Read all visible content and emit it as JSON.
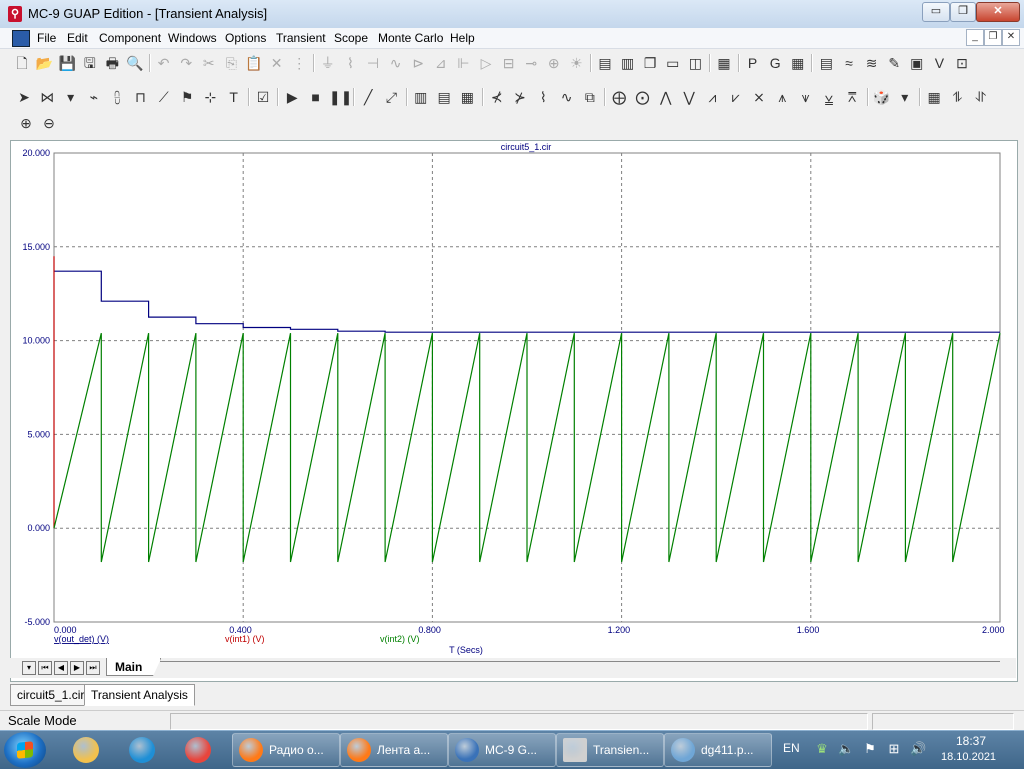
{
  "app": {
    "title": "MC-9 GUAP Edition - [Transient Analysis]",
    "controls": {
      "minimize": "▭",
      "restore": "❐",
      "close": "✕"
    }
  },
  "menu": {
    "items": [
      "File",
      "Edit",
      "Component",
      "Windows",
      "Options",
      "Transient",
      "Scope",
      "Monte Carlo",
      "Help"
    ],
    "mdi_controls": [
      "_",
      "❐",
      "✕"
    ]
  },
  "toolbar1": {
    "icons": [
      {
        "name": "new-file-icon",
        "glyph": "🗋",
        "disabled": false
      },
      {
        "name": "open-file-icon",
        "glyph": "📂",
        "disabled": false
      },
      {
        "name": "save-icon",
        "glyph": "💾",
        "disabled": false
      },
      {
        "name": "save-all-icon",
        "glyph": "🖫",
        "disabled": false
      },
      {
        "name": "print-icon",
        "glyph": "🖶",
        "disabled": false
      },
      {
        "name": "print-preview-icon",
        "glyph": "🔍",
        "disabled": false
      },
      {
        "name": "undo-icon",
        "glyph": "↶",
        "disabled": true
      },
      {
        "name": "redo-icon",
        "glyph": "↷",
        "disabled": true
      },
      {
        "name": "cut-icon",
        "glyph": "✂",
        "disabled": true
      },
      {
        "name": "copy-icon",
        "glyph": "⎘",
        "disabled": true
      },
      {
        "name": "paste-icon",
        "glyph": "📋",
        "disabled": true
      },
      {
        "name": "delete-icon",
        "glyph": "✕",
        "disabled": true
      },
      {
        "name": "select-all-icon",
        "glyph": "⋮",
        "disabled": true
      },
      {
        "name": "ground-icon",
        "glyph": "⏚",
        "disabled": true
      },
      {
        "name": "resistor-icon",
        "glyph": "⌇",
        "disabled": true
      },
      {
        "name": "capacitor-icon",
        "glyph": "⊣",
        "disabled": true
      },
      {
        "name": "inductor-icon",
        "glyph": "∿",
        "disabled": true
      },
      {
        "name": "diode-icon",
        "glyph": "⊳",
        "disabled": true
      },
      {
        "name": "transistor-icon",
        "glyph": "⊿",
        "disabled": true
      },
      {
        "name": "mosfet-icon",
        "glyph": "⊩",
        "disabled": true
      },
      {
        "name": "opamp-icon",
        "glyph": "▷",
        "disabled": true
      },
      {
        "name": "battery-icon",
        "glyph": "⊟",
        "disabled": true
      },
      {
        "name": "source-icon",
        "glyph": "⊸",
        "disabled": true
      },
      {
        "name": "probe-icon",
        "glyph": "⊕",
        "disabled": true
      },
      {
        "name": "bulb-icon",
        "glyph": "☀",
        "disabled": true
      },
      {
        "name": "layout-1-icon",
        "glyph": "▤",
        "disabled": false
      },
      {
        "name": "layout-2-icon",
        "glyph": "▥",
        "disabled": false
      },
      {
        "name": "cascade-icon",
        "glyph": "❐",
        "disabled": false
      },
      {
        "name": "tile-icon",
        "glyph": "▭",
        "disabled": false
      },
      {
        "name": "window-icon",
        "glyph": "◫",
        "disabled": false
      },
      {
        "name": "calculator-icon",
        "glyph": "▦",
        "disabled": false
      },
      {
        "name": "p-text-icon",
        "glyph": "P",
        "disabled": false
      },
      {
        "name": "g-text-icon",
        "glyph": "G",
        "disabled": false
      },
      {
        "name": "grid-icon",
        "glyph": "▦",
        "disabled": false
      },
      {
        "name": "table-icon",
        "glyph": "▤",
        "disabled": false
      },
      {
        "name": "wave-icon",
        "glyph": "≈",
        "disabled": false
      },
      {
        "name": "zigzag-icon",
        "glyph": "≋",
        "disabled": false
      },
      {
        "name": "pencil-icon",
        "glyph": "✎",
        "disabled": false
      },
      {
        "name": "monitor-icon",
        "glyph": "▣",
        "disabled": false
      },
      {
        "name": "vi-icon",
        "glyph": "V",
        "disabled": false
      },
      {
        "name": "zoom-window-icon",
        "glyph": "⊡",
        "disabled": false
      }
    ]
  },
  "toolbar2": {
    "icons": [
      {
        "name": "select-arrow-icon",
        "glyph": "➤"
      },
      {
        "name": "component-mode-icon",
        "glyph": "⋈"
      },
      {
        "name": "dropdown-icon",
        "glyph": "▾"
      },
      {
        "name": "wire-icon",
        "glyph": "⌁"
      },
      {
        "name": "bus-icon",
        "glyph": "⩉"
      },
      {
        "name": "node-icon",
        "glyph": "⊓"
      },
      {
        "name": "diagonal-icon",
        "glyph": "⟋"
      },
      {
        "name": "flag-icon",
        "glyph": "⚑"
      },
      {
        "name": "pin-icon",
        "glyph": "⊹"
      },
      {
        "name": "text-icon",
        "glyph": "T"
      },
      {
        "name": "properties-icon",
        "glyph": "☑"
      },
      {
        "name": "run-icon",
        "glyph": "▶"
      },
      {
        "name": "stop-icon",
        "glyph": "■"
      },
      {
        "name": "pause-icon",
        "glyph": "❚❚"
      },
      {
        "name": "line-icon",
        "glyph": "╱"
      },
      {
        "name": "cursor-line-icon",
        "glyph": "⤢"
      },
      {
        "name": "grid-fine-icon",
        "glyph": "▥"
      },
      {
        "name": "grid-coarse-icon",
        "glyph": "▤"
      },
      {
        "name": "grid-off-icon",
        "glyph": "▦"
      },
      {
        "name": "cursor-a-icon",
        "glyph": "⊀"
      },
      {
        "name": "cursor-b-icon",
        "glyph": "⊁"
      },
      {
        "name": "tracking-icon",
        "glyph": "⌇"
      },
      {
        "name": "curve-icon",
        "glyph": "∿"
      },
      {
        "name": "scale-icon",
        "glyph": "⧉"
      },
      {
        "name": "crosshair-h-icon",
        "glyph": "⨁"
      },
      {
        "name": "crosshair-v-icon",
        "glyph": "⨀"
      },
      {
        "name": "peak-icon",
        "glyph": "⋀"
      },
      {
        "name": "valley-icon",
        "glyph": "⋁"
      },
      {
        "name": "high-icon",
        "glyph": "⩘"
      },
      {
        "name": "low-icon",
        "glyph": "⩗"
      },
      {
        "name": "inflection-icon",
        "glyph": "⨯"
      },
      {
        "name": "global-high-icon",
        "glyph": "⩚"
      },
      {
        "name": "global-low-icon",
        "glyph": "⩛"
      },
      {
        "name": "slope-icon",
        "glyph": "⩣"
      },
      {
        "name": "multiple-peak-icon",
        "glyph": "⩞"
      },
      {
        "name": "animate-icon",
        "glyph": "🎲"
      },
      {
        "name": "dropdown2-icon",
        "glyph": "▾"
      },
      {
        "name": "table-grid-icon",
        "glyph": "▦"
      },
      {
        "name": "step-icon",
        "glyph": "⥮"
      },
      {
        "name": "step-back-icon",
        "glyph": "⥯"
      }
    ]
  },
  "toolbar3": {
    "icons": [
      {
        "name": "zoom-in-icon",
        "glyph": "⊕"
      },
      {
        "name": "zoom-out-icon",
        "glyph": "⊖"
      }
    ]
  },
  "plot": {
    "title": "circuit5_1.cir",
    "x_title": "T (Secs)",
    "legend": [
      {
        "label": "v(out_det) (V)",
        "color": "#000080"
      },
      {
        "label": "v(int1) (V)",
        "color": "#c00000"
      },
      {
        "label": "v(int2) (V)",
        "color": "#008000"
      }
    ]
  },
  "chart_data": {
    "type": "line",
    "title": "circuit5_1.cir",
    "xlabel": "T (Secs)",
    "ylabel": "",
    "xlim": [
      0,
      2
    ],
    "ylim": [
      -5,
      20
    ],
    "x_ticks": [
      "0.000",
      "0.400",
      "0.800",
      "1.200",
      "1.600",
      "2.000"
    ],
    "y_ticks": [
      "-5.000",
      "0.000",
      "5.000",
      "10.000",
      "15.000",
      "20.000"
    ],
    "grid": true,
    "series": [
      {
        "name": "v(out_det) (V)",
        "color": "#000080",
        "x": [
          0,
          0.1,
          0.1,
          0.2,
          0.2,
          0.3,
          0.3,
          0.4,
          0.4,
          0.5,
          0.5,
          0.6,
          0.6,
          0.7,
          0.7,
          2.0
        ],
        "y": [
          13.7,
          13.7,
          12.1,
          12.1,
          11.25,
          11.25,
          10.9,
          10.9,
          10.7,
          10.7,
          10.6,
          10.6,
          10.5,
          10.5,
          10.45,
          10.45
        ]
      },
      {
        "name": "v(int1) (V)",
        "color": "#c00000",
        "x": [
          0,
          0
        ],
        "y": [
          0,
          14.5
        ]
      },
      {
        "name": "v(int2) (V)",
        "color": "#008000",
        "x": [
          0,
          0.1,
          0.1,
          0.2,
          0.2,
          0.3,
          0.3,
          0.4,
          0.4,
          0.5,
          0.5,
          0.6,
          0.6,
          0.7,
          0.7,
          0.8,
          0.8,
          0.9,
          0.9,
          1.0,
          1.0,
          1.1,
          1.1,
          1.2,
          1.2,
          1.3,
          1.3,
          1.4,
          1.4,
          1.5,
          1.5,
          1.6,
          1.6,
          1.7,
          1.7,
          1.8,
          1.8,
          1.9,
          1.9,
          2.0
        ],
        "y": [
          0,
          10.4,
          -1.8,
          10.4,
          -1.8,
          10.4,
          -1.8,
          10.4,
          -1.8,
          10.4,
          -1.8,
          10.4,
          -1.8,
          10.4,
          -1.8,
          10.4,
          -1.8,
          10.4,
          -1.8,
          10.4,
          -1.8,
          10.4,
          -1.8,
          10.4,
          -1.8,
          10.4,
          -1.8,
          10.4,
          -1.8,
          10.4,
          -1.8,
          10.4,
          -1.8,
          10.4,
          -1.8,
          10.4,
          -1.8,
          10.4,
          -1.8,
          10.4
        ]
      }
    ]
  },
  "plot_tabs": {
    "active": "Main",
    "nav": [
      "▾",
      "⏮",
      "◀",
      "▶",
      "⏭"
    ]
  },
  "doc_tabs": [
    "circuit5_1.cir",
    "Transient Analysis"
  ],
  "status": {
    "text": "Scale Mode"
  },
  "taskbar": {
    "pinned": [
      {
        "name": "explorer-icon",
        "color": "#f2c14e"
      },
      {
        "name": "edge-icon",
        "color": "#1e8fd6"
      },
      {
        "name": "chrome-icon",
        "color": "#e8453c"
      }
    ],
    "tasks": [
      {
        "label": "Радио о...",
        "icon": "firefox-icon",
        "color": "#ff7a18"
      },
      {
        "label": "Лента а...",
        "icon": "firefox-icon",
        "color": "#ff7a18"
      },
      {
        "label": "MC-9 G...",
        "icon": "mc9-icon",
        "color": "#3a72b8"
      },
      {
        "label": "Transien...",
        "icon": "chart-window-icon",
        "color": "#d0d0d0"
      },
      {
        "label": "dg411.p...",
        "icon": "magnifier-icon",
        "color": "#6fa6d6"
      }
    ],
    "lang": "EN",
    "time": "18:37",
    "date": "18.10.2021"
  }
}
